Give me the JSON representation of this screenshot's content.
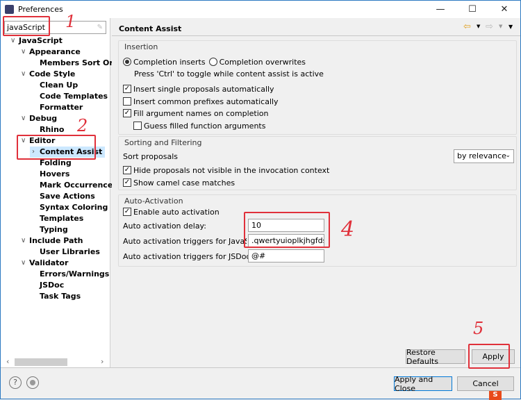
{
  "window": {
    "title": "Preferences",
    "icon": "eclipse-icon",
    "controls": [
      "minimize",
      "maximize",
      "close"
    ]
  },
  "sidebar": {
    "search_value": "javaScript",
    "items": [
      {
        "label": "JavaScript",
        "level": 0,
        "expanded": true
      },
      {
        "label": "Appearance",
        "level": 1,
        "expanded": true
      },
      {
        "label": "Members Sort Orde",
        "level": 2
      },
      {
        "label": "Code Style",
        "level": 1,
        "expanded": true
      },
      {
        "label": "Clean Up",
        "level": 2
      },
      {
        "label": "Code Templates",
        "level": 2
      },
      {
        "label": "Formatter",
        "level": 2
      },
      {
        "label": "Debug",
        "level": 1,
        "expanded": true
      },
      {
        "label": "Rhino",
        "level": 2
      },
      {
        "label": "Editor",
        "level": 1,
        "expanded": true
      },
      {
        "label": "Content Assist",
        "level": 2,
        "selected": true,
        "collapsed": true
      },
      {
        "label": "Folding",
        "level": 2
      },
      {
        "label": "Hovers",
        "level": 2
      },
      {
        "label": "Mark Occurrences",
        "level": 2
      },
      {
        "label": "Save Actions",
        "level": 2
      },
      {
        "label": "Syntax Coloring",
        "level": 2
      },
      {
        "label": "Templates",
        "level": 2
      },
      {
        "label": "Typing",
        "level": 2
      },
      {
        "label": "Include Path",
        "level": 1,
        "expanded": true
      },
      {
        "label": "User Libraries",
        "level": 2
      },
      {
        "label": "Validator",
        "level": 1,
        "expanded": true
      },
      {
        "label": "Errors/Warnings",
        "level": 2
      },
      {
        "label": "JSDoc",
        "level": 2
      },
      {
        "label": "Task Tags",
        "level": 2
      }
    ]
  },
  "main": {
    "title": "Content Assist",
    "insertion": {
      "title": "Insertion",
      "radio_inserts": "Completion inserts",
      "radio_overwrites": "Completion overwrites",
      "selected": "inserts",
      "hint": "Press 'Ctrl' to toggle while content assist is active",
      "checks": [
        {
          "label": "Insert single proposals automatically",
          "checked": true
        },
        {
          "label": "Insert common prefixes automatically",
          "checked": false
        },
        {
          "label": "Fill argument names on completion",
          "checked": true
        },
        {
          "label": "Guess filled function arguments",
          "checked": false
        }
      ]
    },
    "sorting": {
      "title": "Sorting and Filtering",
      "sort_label": "Sort proposals",
      "sort_value": "by relevance",
      "checks": [
        {
          "label": "Hide proposals not visible in the invocation context",
          "checked": true
        },
        {
          "label": "Show camel case matches",
          "checked": true
        }
      ]
    },
    "auto": {
      "title": "Auto-Activation",
      "enable_label": "Enable auto activation",
      "enable_checked": true,
      "delay_label": "Auto activation delay:",
      "delay_value": "10",
      "js_label": "Auto activation triggers for JavaScript:",
      "js_value": ".qwertyuioplkjhgfdsaz",
      "jsdoc_label": "Auto activation triggers for JSDoc:",
      "jsdoc_value": "@#"
    },
    "restore_label": "Restore Defaults",
    "apply_label": "Apply"
  },
  "footer": {
    "apply_close_label": "Apply and Close",
    "cancel_label": "Cancel"
  },
  "annotations": {
    "a1": "1",
    "a2": "2",
    "a4": "4",
    "a5": "5",
    "color": "#e0303a"
  }
}
